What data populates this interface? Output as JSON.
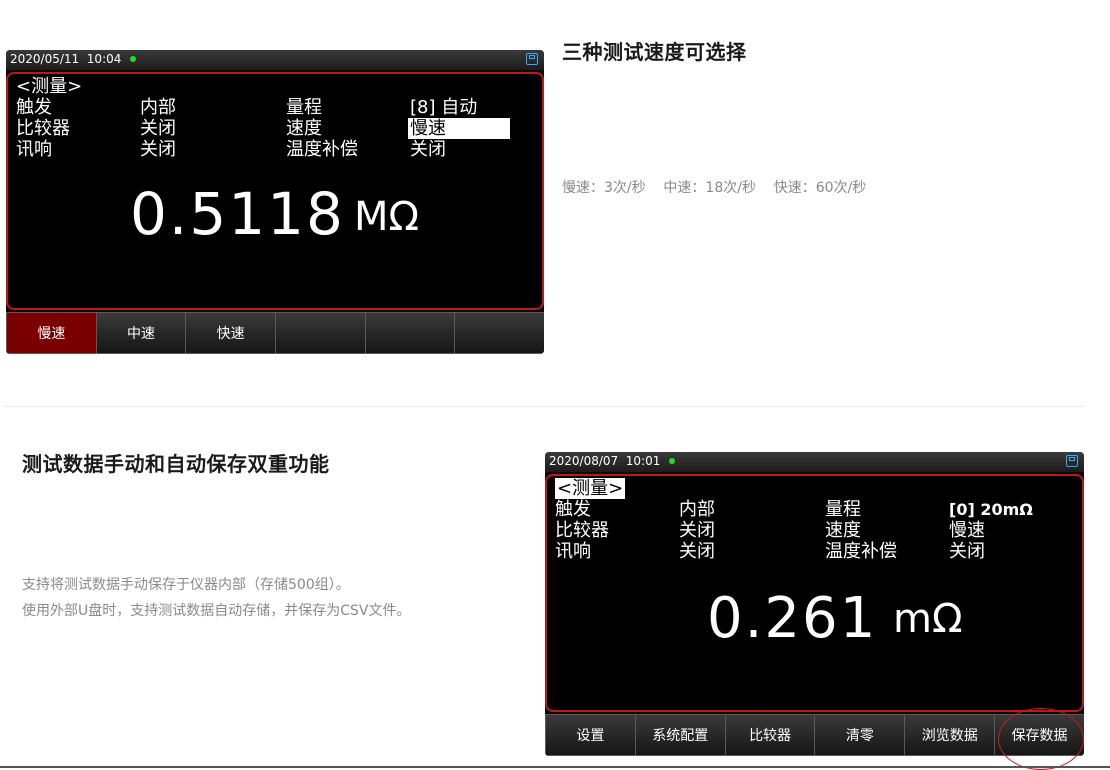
{
  "section1": {
    "title": "三种测试速度可选择",
    "description": "慢速：3次/秒    中速：18次/秒    快速：60次/秒"
  },
  "section2": {
    "title": "测试数据手动和自动保存双重功能",
    "description_line1": "支持将测试数据手动保存于仪器内部（存储500组）。",
    "description_line2": "使用外部U盘时，支持测试数据自动存储，并保存为CSV文件。"
  },
  "screen1": {
    "datetime": "2020/05/11  10:04",
    "mode_title": "<测量>",
    "rows": [
      {
        "label": "触发",
        "value": "内部",
        "label2": "量程",
        "value2": "[8] 自动"
      },
      {
        "label": "比较器",
        "value": "关闭",
        "label2": "速度",
        "value2": "慢速"
      },
      {
        "label": "讯响",
        "value": "关闭",
        "label2": "温度补偿",
        "value2": "关闭"
      }
    ],
    "reading": "0.5118",
    "unit": "MΩ",
    "softkeys": [
      "慢速",
      "中速",
      "快速",
      "",
      "",
      ""
    ],
    "active_softkey": 0
  },
  "screen2": {
    "datetime": "2020/08/07  10:01",
    "mode_title": "<测量>",
    "rows": [
      {
        "label": "触发",
        "value": "内部",
        "label2": "量程",
        "value2": "[0] 20mΩ"
      },
      {
        "label": "比较器",
        "value": "关闭",
        "label2": "速度",
        "value2": "慢速"
      },
      {
        "label": "讯响",
        "value": "关闭",
        "label2": "温度补偿",
        "value2": "关闭"
      }
    ],
    "reading": "0.261",
    "unit": "mΩ",
    "softkeys": [
      "设置",
      "系统配置",
      "比较器",
      "清零",
      "浏览数据",
      "保存数据"
    ]
  },
  "colors": {
    "panel_border": "#c01818",
    "active_key": "#7a0000",
    "status_dot": "#22dd22",
    "highlight_circle": "#d01818"
  }
}
